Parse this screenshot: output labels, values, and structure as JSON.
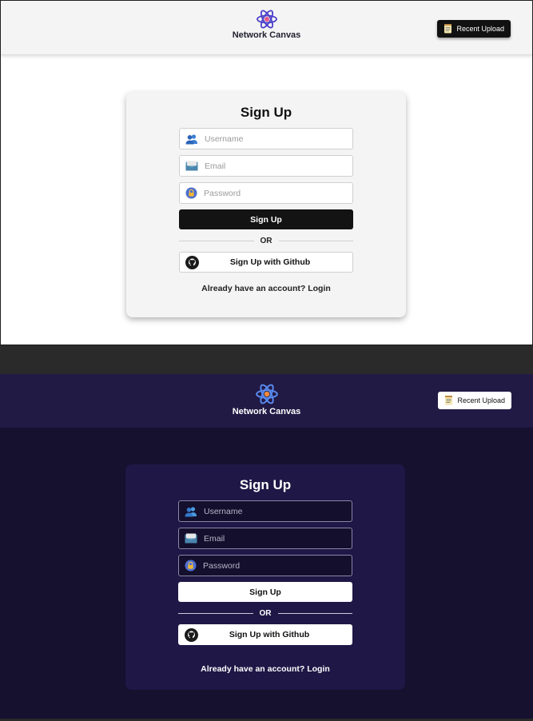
{
  "app": {
    "name": "Network Canvas"
  },
  "header": {
    "recent_upload_label": "Recent Upload"
  },
  "form": {
    "title": "Sign Up",
    "username_placeholder": "Username",
    "email_placeholder": "Email",
    "password_placeholder": "Password",
    "submit_label": "Sign Up",
    "divider_text": "OR",
    "github_label": "Sign Up with Github",
    "login_prompt": "Already have an account?",
    "login_link": "Login"
  },
  "colors": {
    "light_bg": "#ffffff",
    "dark_bg": "#15112f",
    "dark_header": "#211a45",
    "dark_card": "#1f1746",
    "accent_dark": "#131313"
  },
  "icons": [
    "atom-logo-icon",
    "notepad-icon",
    "users-icon",
    "email-icon",
    "lock-icon",
    "github-icon"
  ]
}
